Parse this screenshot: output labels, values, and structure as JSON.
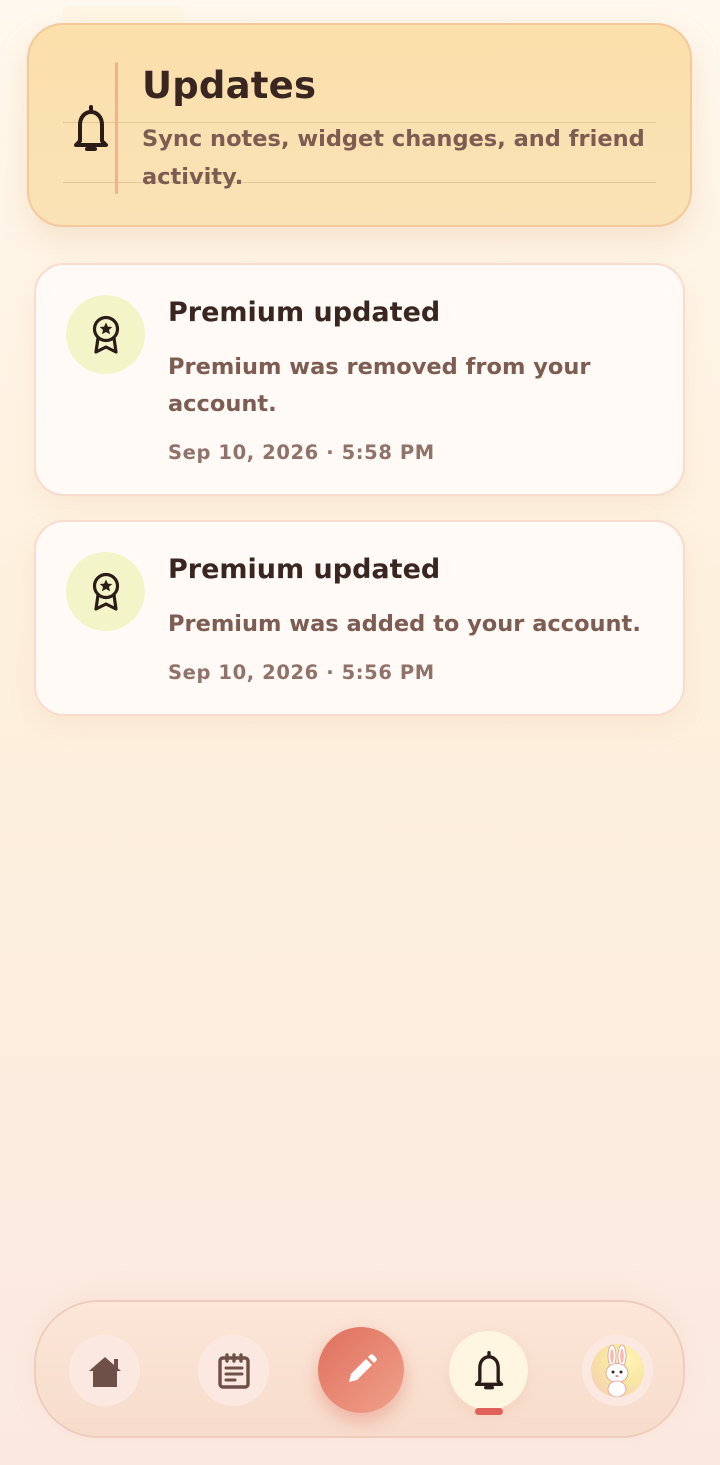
{
  "header": {
    "title": "Updates",
    "subtitle": "Sync notes, widget changes, and friend activity.",
    "icon": "bell-icon"
  },
  "notifications": [
    {
      "icon": "award-badge-icon",
      "title": "Premium updated",
      "body": "Premium was removed from your account.",
      "timestamp": "Sep 10, 2026 · 5:58 PM"
    },
    {
      "icon": "award-badge-icon",
      "title": "Premium updated",
      "body": "Premium was added to your account.",
      "timestamp": "Sep 10, 2026 · 5:56 PM"
    }
  ],
  "bottom_nav": {
    "items": [
      {
        "icon": "home-icon",
        "active": false
      },
      {
        "icon": "notepad-icon",
        "active": false
      },
      {
        "icon": "pencil-icon",
        "active": false,
        "primary": true
      },
      {
        "icon": "bell-icon",
        "active": true
      },
      {
        "icon": "bunny-avatar",
        "active": false
      }
    ]
  },
  "colors": {
    "accent": "#df6f5e",
    "header_bg": "#fbe0ab",
    "card_bg": "#fffaf5",
    "icon_circle": "#f3f5c8",
    "text_dark": "#3a2621",
    "text_muted": "#7d5c52",
    "active_indicator": "#e0605a"
  }
}
